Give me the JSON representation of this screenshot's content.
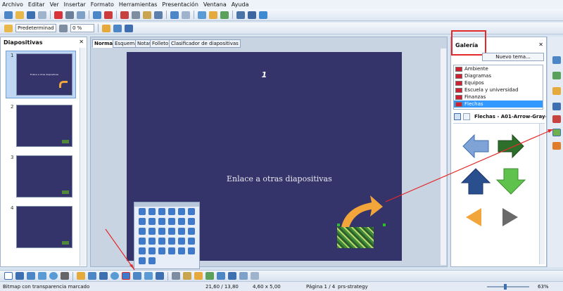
{
  "menu": [
    "Archivo",
    "Editar",
    "Ver",
    "Insertar",
    "Formato",
    "Herramientas",
    "Presentación",
    "Ventana",
    "Ayuda"
  ],
  "toolbar2": {
    "line_style": "Predeterminad",
    "transparency": "0 %"
  },
  "slides_panel": {
    "title": "Diapositivas",
    "slides": [
      "1",
      "2",
      "3",
      "4"
    ],
    "thumb_text": "Enlace a otras diapositivas"
  },
  "tabs": [
    "Normal",
    "Esquema",
    "Notas",
    "Folleto",
    "Clasificador de diapositivas"
  ],
  "slide": {
    "number": "1",
    "text": "Enlace a otras diapositivas"
  },
  "gallery": {
    "title": "Galería",
    "new_theme": "Nuevo tema...",
    "themes": [
      "Ambiente",
      "Diagramas",
      "Equipos",
      "Escuela y universidad",
      "Finanzas",
      "Flechas"
    ],
    "selected": "Flechas",
    "view_title": "Flechas - A01-Arrow-Gray-Le"
  },
  "status": {
    "left": "Bitmap con transparencia marcado",
    "position": "21,60 / 13,80",
    "size": "4,60 x 5,00",
    "page": "Página 1 / 4",
    "style": "prs-strategy",
    "zoom": "63%"
  },
  "colors": {
    "slide_bg": "#34336a",
    "highlight": "#e32a2a",
    "accent_orange": "#f2a53a",
    "selection": "#3399ff"
  }
}
